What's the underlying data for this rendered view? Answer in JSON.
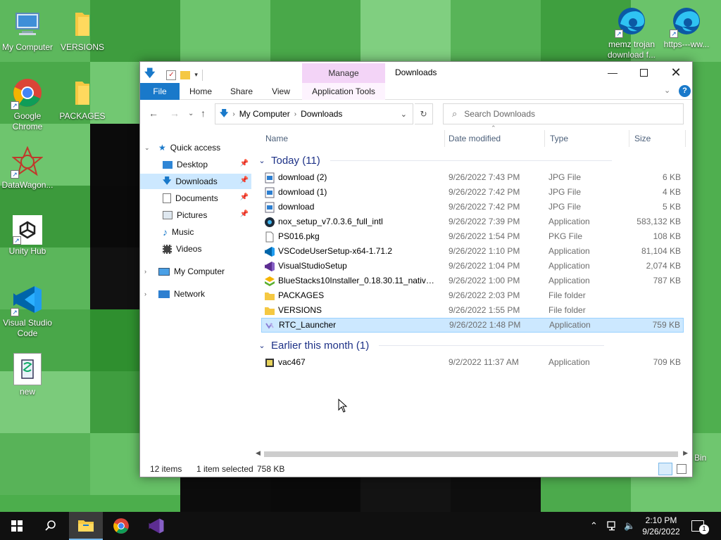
{
  "desktop": {
    "icons": [
      {
        "label": "My Computer"
      },
      {
        "label": "VERSIONS"
      },
      {
        "label": "Google Chrome"
      },
      {
        "label": "PACKAGES"
      },
      {
        "label": "DataWagon..."
      },
      {
        "label": "Unity Hub"
      },
      {
        "label": "Visual Studio Code"
      },
      {
        "label": "new"
      },
      {
        "label": "memz trojan download f..."
      },
      {
        "label": "https---ww..."
      },
      {
        "label": "Bin"
      }
    ]
  },
  "window": {
    "title": "Downloads",
    "manage_tab": "Manage",
    "ribbon_tabs": [
      "File",
      "Home",
      "Share",
      "View",
      "Application Tools"
    ],
    "breadcrumb": [
      "My Computer",
      "Downloads"
    ],
    "search_placeholder": "Search Downloads",
    "columns": [
      "Name",
      "Date modified",
      "Type",
      "Size"
    ],
    "nav": [
      {
        "label": "Quick access"
      },
      {
        "label": "Desktop"
      },
      {
        "label": "Downloads"
      },
      {
        "label": "Documents"
      },
      {
        "label": "Pictures"
      },
      {
        "label": "Music"
      },
      {
        "label": "Videos"
      },
      {
        "label": "My Computer"
      },
      {
        "label": "Network"
      }
    ],
    "groups": [
      {
        "label": "Today (11)"
      },
      {
        "label": "Earlier this month (1)"
      }
    ],
    "files": [
      {
        "name": "download (2)",
        "date": "9/26/2022 7:43 PM",
        "type": "JPG File",
        "size": "6 KB"
      },
      {
        "name": "download (1)",
        "date": "9/26/2022 7:42 PM",
        "type": "JPG File",
        "size": "4 KB"
      },
      {
        "name": "download",
        "date": "9/26/2022 7:42 PM",
        "type": "JPG File",
        "size": "5 KB"
      },
      {
        "name": "nox_setup_v7.0.3.6_full_intl",
        "date": "9/26/2022 7:39 PM",
        "type": "Application",
        "size": "583,132 KB"
      },
      {
        "name": "PS016.pkg",
        "date": "9/26/2022 1:54 PM",
        "type": "PKG File",
        "size": "108 KB"
      },
      {
        "name": "VSCodeUserSetup-x64-1.71.2",
        "date": "9/26/2022 1:10 PM",
        "type": "Application",
        "size": "81,104 KB"
      },
      {
        "name": "VisualStudioSetup",
        "date": "9/26/2022 1:04 PM",
        "type": "Application",
        "size": "2,074 KB"
      },
      {
        "name": "BlueStacks10Installer_0.18.30.11_native_ef...",
        "date": "9/26/2022 1:00 PM",
        "type": "Application",
        "size": "787 KB"
      },
      {
        "name": "PACKAGES",
        "date": "9/26/2022 2:03 PM",
        "type": "File folder",
        "size": ""
      },
      {
        "name": "VERSIONS",
        "date": "9/26/2022 1:55 PM",
        "type": "File folder",
        "size": ""
      },
      {
        "name": "RTC_Launcher",
        "date": "9/26/2022 1:48 PM",
        "type": "Application",
        "size": "759 KB"
      },
      {
        "name": "vac467",
        "date": "9/2/2022 11:37 AM",
        "type": "Application",
        "size": "709 KB"
      }
    ],
    "status": {
      "items": "12 items",
      "selected": "1 item selected",
      "selected_size": "758 KB"
    }
  },
  "taskbar": {
    "time": "2:10 PM",
    "date": "9/26/2022",
    "notification_count": "1"
  },
  "colors": {
    "accent": "#1979ca",
    "selection": "#cce8ff",
    "manage": "#f3d4f7"
  }
}
